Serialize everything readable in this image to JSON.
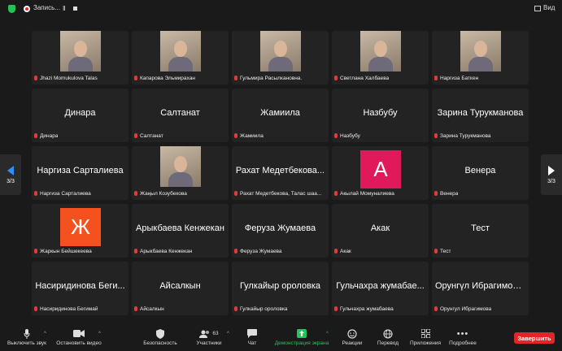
{
  "topbar": {
    "recording_label": "Запись...",
    "pause_glyph": "II",
    "view_label": "Вид"
  },
  "navigation": {
    "page_left": "3/3",
    "page_right": "3/3"
  },
  "participants": [
    {
      "name": "Jhazi Momukulova Talas",
      "display": "",
      "type": "photo"
    },
    {
      "name": "Капарова Эльмирахан",
      "display": "",
      "type": "photo"
    },
    {
      "name": "Гульмира Расылкановна.",
      "display": "",
      "type": "photo"
    },
    {
      "name": "Светлана Халбаева",
      "display": "",
      "type": "photo"
    },
    {
      "name": "Наргиза Баткен",
      "display": "",
      "type": "photo"
    },
    {
      "name": "Динара",
      "display": "Динара",
      "type": "text"
    },
    {
      "name": "Салтанат",
      "display": "Салтанат",
      "type": "text"
    },
    {
      "name": "Жамиила",
      "display": "Жамиила",
      "type": "text"
    },
    {
      "name": "Назбубу",
      "display": "Назбубу",
      "type": "text"
    },
    {
      "name": "Зарина Турукманова",
      "display": "Зарина Турукманова",
      "type": "text"
    },
    {
      "name": "Наргиза Сарталиева",
      "display": "Наргиза Сарталиева",
      "type": "text"
    },
    {
      "name": "Жаңыл Козубекова",
      "display": "",
      "type": "photo"
    },
    {
      "name": "Рахат Медетбекова, Талас шаа...",
      "display": "Рахат Медетбекова...",
      "type": "text"
    },
    {
      "name": "Акылай Момуналиева",
      "display": "A",
      "type": "avatar",
      "color": "#e0195a"
    },
    {
      "name": "Венера",
      "display": "Венера",
      "type": "text"
    },
    {
      "name": "Жаркын Бейшекеева",
      "display": "Ж",
      "type": "avatar",
      "color": "#f4511e"
    },
    {
      "name": "Арыкбаева Кенжекан",
      "display": "Арыкбаева Кенжекан",
      "type": "text"
    },
    {
      "name": "Феруза Жумаева",
      "display": "Феруза Жумаева",
      "type": "text"
    },
    {
      "name": "Акак",
      "display": "Акак",
      "type": "text"
    },
    {
      "name": "Тест",
      "display": "Тест",
      "type": "text"
    },
    {
      "name": "Насиридинова Бегимай",
      "display": "Насиридинова Беги...",
      "type": "text"
    },
    {
      "name": "Айсалкын",
      "display": "Айсалкын",
      "type": "text"
    },
    {
      "name": "Гулкайыр ороловка",
      "display": "Гулкайыр ороловка",
      "type": "text"
    },
    {
      "name": "Гульчахра жумабаева",
      "display": "Гульчахра жумабае...",
      "type": "text"
    },
    {
      "name": "Орунгул Ибрагимова",
      "display": "Орунгүл Ибрагимово...",
      "type": "text"
    }
  ],
  "toolbar": {
    "mute": "Выключить звук",
    "video": "Остановить видео",
    "security": "Безопасность",
    "participants": "Участники",
    "participants_count": "63",
    "chat": "Чат",
    "share": "Демонстрация экрана",
    "reactions": "Реакции",
    "translate": "Перевод",
    "apps": "Приложения",
    "more": "Подробнее",
    "end": "Завершить"
  },
  "colors": {
    "share_green": "#26c456",
    "end_red": "#e0262b",
    "nav_blue": "#2f8fff",
    "muted_red": "#e23b3b"
  }
}
